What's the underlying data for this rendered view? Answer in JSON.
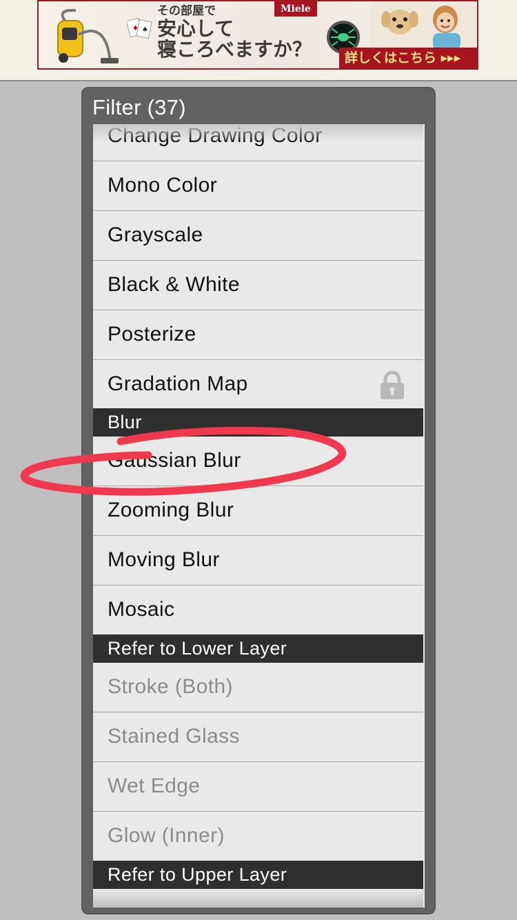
{
  "ad": {
    "brand": "Miele",
    "line1": "その部屋で",
    "line2": "安心して",
    "line3": "寝ころべますか？",
    "cta": "詳しくはこちら ▸▸▸"
  },
  "panel": {
    "title": "Filter (37)",
    "items": [
      {
        "label": "Change Drawing Color",
        "kind": "item"
      },
      {
        "label": "Mono Color",
        "kind": "item"
      },
      {
        "label": "Grayscale",
        "kind": "item"
      },
      {
        "label": "Black & White",
        "kind": "item"
      },
      {
        "label": "Posterize",
        "kind": "item"
      },
      {
        "label": "Gradation Map",
        "kind": "item",
        "locked": true
      },
      {
        "label": "Blur",
        "kind": "section"
      },
      {
        "label": "Gaussian Blur",
        "kind": "item"
      },
      {
        "label": "Zooming Blur",
        "kind": "item"
      },
      {
        "label": "Moving Blur",
        "kind": "item"
      },
      {
        "label": "Mosaic",
        "kind": "item"
      },
      {
        "label": "Refer to Lower Layer",
        "kind": "section"
      },
      {
        "label": "Stroke (Both)",
        "kind": "item",
        "disabled": true
      },
      {
        "label": "Stained Glass",
        "kind": "item",
        "disabled": true
      },
      {
        "label": "Wet Edge",
        "kind": "item",
        "disabled": true
      },
      {
        "label": "Glow (Inner)",
        "kind": "item",
        "disabled": true
      },
      {
        "label": "Refer to Upper Layer",
        "kind": "section"
      }
    ]
  },
  "colors": {
    "annotation": "#f0384f",
    "section_bg": "#2f2f2f",
    "row_bg": "#e9e9e9",
    "disabled_text": "#8c8c8c"
  }
}
